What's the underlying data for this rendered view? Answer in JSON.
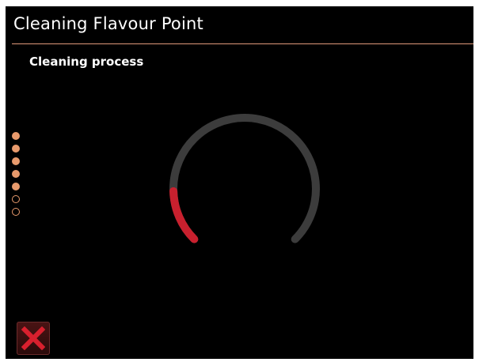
{
  "header": {
    "title": "Cleaning Flavour Point"
  },
  "main": {
    "subtitle": "Cleaning process"
  },
  "steps": {
    "total": 7,
    "completed": 5
  },
  "progress": {
    "value": 0.16
  },
  "colors": {
    "accent": "#e89a6c",
    "progress_fill": "#c8202e",
    "progress_track": "#3c3c3c",
    "close_icon": "#d8202e"
  },
  "icons": {
    "close": "close-icon"
  }
}
